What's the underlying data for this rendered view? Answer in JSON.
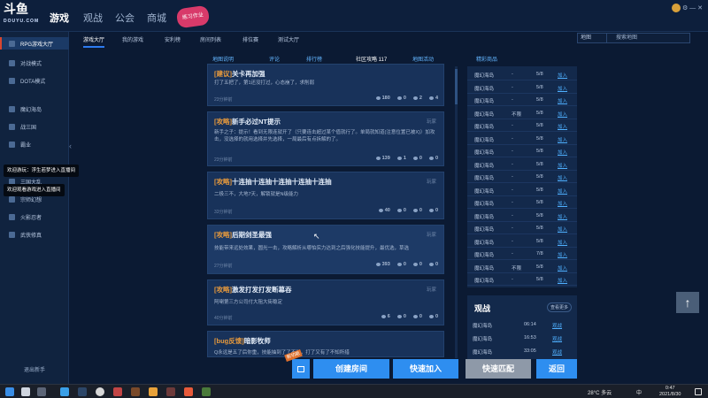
{
  "topbar": {
    "logo": "斗鱼",
    "logo_sub": "DOUYU.COM",
    "nav": [
      "游戏",
      "观战",
      "公会",
      "商城"
    ],
    "promo": "练习作业"
  },
  "sidebar": {
    "items": [
      {
        "label": "RPG游戏大厅"
      },
      {
        "label": "对战模式"
      },
      {
        "label": "DOTA模式"
      },
      {
        "label": "魔幻海岛"
      },
      {
        "label": "战三国"
      },
      {
        "label": "霸业"
      },
      {
        "label": "三国大乱"
      },
      {
        "label": "宗师幻想"
      },
      {
        "label": "火影忍者"
      },
      {
        "label": "武侠修真"
      }
    ],
    "toasts": [
      "欢迎游玩：浮生若梦进入直播间",
      "欢迎观看游戏进入直播间"
    ],
    "exit": "退出新手"
  },
  "subtabs": [
    "游戏大厅",
    "我的游戏",
    "安利榜",
    "房间列表",
    "排位赛",
    "测试大厅"
  ],
  "filter": "地图",
  "search_placeholder": "搜索地图",
  "game_tabs": [
    "地图说明",
    "评论",
    "排行榜",
    "社区攻略 117",
    "地图活动",
    "精彩商品"
  ],
  "posts": [
    {
      "tag": "[建议]",
      "title": "关卡再加强",
      "author": "",
      "body": "打了五把了，第1还没打过，心态崩了，求削弱",
      "time": "23分钟前",
      "views": "180",
      "likes": "0",
      "comments": "2",
      "shares": "4"
    },
    {
      "tag": "[攻略]",
      "title": "新手必过NT提示",
      "author": "玩家",
      "body": "新手之子：提示！看到无限连就开了（只要连击超过某个值就行了。单局就知道(注意位置已被X)）加攻击，没选择的就用选择并先选择，一局最后有点拆解的了。",
      "time": "23分钟前",
      "views": "139",
      "likes": "1",
      "comments": "0",
      "shares": "0"
    },
    {
      "tag": "[攻略]",
      "title": "十连抽十连抽十连抽十连抽十连抽",
      "author": "玩家",
      "body": "二极三不，大地7天，解锁就是N级能力",
      "time": "33分钟前",
      "views": "40",
      "likes": "0",
      "comments": "0",
      "shares": "0"
    },
    {
      "tag": "[攻略]",
      "title": "后期剑圣最强",
      "author": "玩家",
      "body": "技能带来远处效果，圆光一击，攻略解析从哪怕实力达到之后强化技能提升，最优选，草选",
      "time": "27分钟前",
      "views": "393",
      "likes": "0",
      "comments": "0",
      "shares": "0"
    },
    {
      "tag": "[攻略]",
      "title": "激发打发打发断幕吞",
      "author": "玩家",
      "body": "阿喇第三方公司付大阻大街稳定",
      "time": "40分钟前",
      "views": "6",
      "likes": "0",
      "comments": "0",
      "shares": "0"
    },
    {
      "tag": "[bug反馈]",
      "title": "暗影牧师",
      "author": "",
      "body": "Q永远是五了后你重，技能抽到了了不对，打了又有了不知所措",
      "time": "",
      "views": "",
      "likes": "",
      "comments": "",
      "shares": ""
    }
  ],
  "room_table": [
    {
      "name": "魔幻海岛",
      "mode": "-",
      "count": "5/8",
      "action": "加入"
    },
    {
      "name": "魔幻海岛",
      "mode": "-",
      "count": "5/8",
      "action": "加入"
    },
    {
      "name": "魔幻海岛",
      "mode": "-",
      "count": "5/8",
      "action": "加入"
    },
    {
      "name": "魔幻海岛",
      "mode": "不限",
      "count": "5/8",
      "action": "加入"
    },
    {
      "name": "魔幻海岛",
      "mode": "-",
      "count": "5/8",
      "action": "加入"
    },
    {
      "name": "魔幻海岛",
      "mode": "-",
      "count": "5/8",
      "action": "加入"
    },
    {
      "name": "魔幻海岛",
      "mode": "-",
      "count": "5/8",
      "action": "加入"
    },
    {
      "name": "魔幻海岛",
      "mode": "-",
      "count": "5/8",
      "action": "加入"
    },
    {
      "name": "魔幻海岛",
      "mode": "-",
      "count": "5/8",
      "action": "加入"
    },
    {
      "name": "魔幻海岛",
      "mode": "-",
      "count": "5/8",
      "action": "加入"
    },
    {
      "name": "魔幻海岛",
      "mode": "-",
      "count": "5/8",
      "action": "加入"
    },
    {
      "name": "魔幻海岛",
      "mode": "-",
      "count": "5/8",
      "action": "加入"
    },
    {
      "name": "魔幻海岛",
      "mode": "-",
      "count": "5/8",
      "action": "加入"
    },
    {
      "name": "魔幻海岛",
      "mode": "-",
      "count": "5/8",
      "action": "加入"
    },
    {
      "name": "魔幻海岛",
      "mode": "-",
      "count": "7/8",
      "action": "加入"
    },
    {
      "name": "魔幻海岛",
      "mode": "不限",
      "count": "5/8",
      "action": "加入"
    },
    {
      "name": "魔幻海岛",
      "mode": "-",
      "count": "5/8",
      "action": "加入"
    }
  ],
  "watch": {
    "title": "观战",
    "more": "查看更多",
    "rows": [
      {
        "name": "魔幻海岛",
        "time": "06:14",
        "action": "观战"
      },
      {
        "name": "魔幻海岛",
        "time": "16:53",
        "action": "观战"
      },
      {
        "name": "魔幻海岛",
        "time": "33:05",
        "action": "观战"
      }
    ]
  },
  "buttons": {
    "badge": "新功能",
    "create_room": "创建房间",
    "quick_join": "快速加入",
    "quick_match": "快速匹配",
    "back": "返回"
  },
  "taskbar": {
    "weather": "28°C 多云",
    "lang": "中",
    "time": "0:47",
    "date": "2021/8/30"
  },
  "colors": {
    "accent": "#2e8ef0",
    "tag": "#e89a3c",
    "bg": "#0b1a33"
  }
}
